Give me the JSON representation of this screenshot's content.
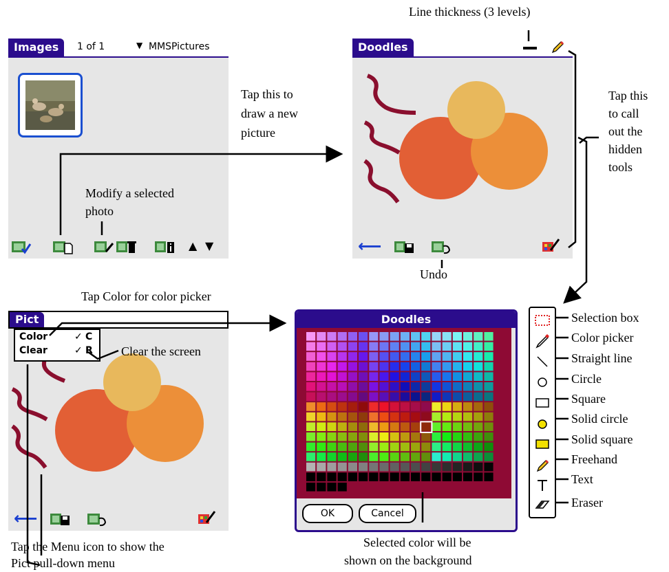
{
  "images_screen": {
    "tab_label": "Images",
    "page_indicator": "1 of 1",
    "category_label": "MMSPictures"
  },
  "doodles_screen": {
    "tab_label": "Doodles"
  },
  "pict_screen": {
    "tab_label": "Pict",
    "menu_items": [
      {
        "label": "Color",
        "shortcut": "C"
      },
      {
        "label": "Clear",
        "shortcut": "R"
      }
    ]
  },
  "color_dialog": {
    "title": "Doodles",
    "ok_label": "OK",
    "cancel_label": "Cancel"
  },
  "annotations": {
    "line_thickness": "Line thickness (3 levels)",
    "tap_new_picture": [
      "Tap this to",
      "draw a new",
      "picture"
    ],
    "modify_photo": [
      "Modify a selected",
      "photo"
    ],
    "hidden_tools": [
      "Tap this",
      "to call",
      "out the",
      "hidden",
      "tools"
    ],
    "undo": "Undo",
    "color_picker_hint": "Tap Color for color picker",
    "clear_screen": "Clear the screen",
    "menu_icon": [
      "Tap the Menu icon to show the",
      "Pict pull-down menu"
    ],
    "selected_color": [
      "Selected color will be",
      "shown on the background"
    ]
  },
  "tool_labels": [
    "Selection box",
    "Color picker",
    "Straight line",
    "Circle",
    "Square",
    "Solid circle",
    "Solid square",
    "Freehand",
    "Text",
    "Eraser"
  ],
  "colors": {
    "title_blue": "#2b0c8c",
    "circle_red": "#e25f35",
    "circle_orange": "#ec8f39",
    "circle_yellow": "#e8b85c",
    "squiggle": "#8a0f2e",
    "dialog_bg": "#8e0a34"
  }
}
